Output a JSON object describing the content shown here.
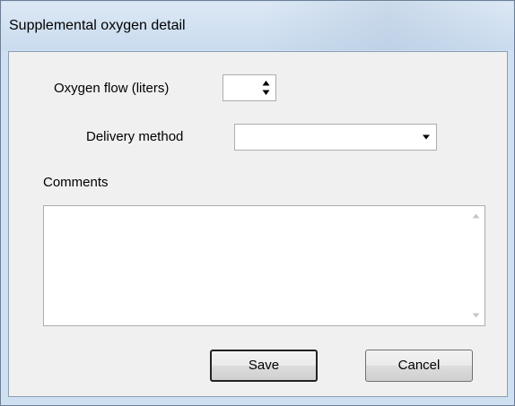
{
  "window": {
    "title": "Supplemental oxygen detail"
  },
  "form": {
    "oxygen_flow_label": "Oxygen flow (liters)",
    "oxygen_flow_value": "",
    "delivery_method_label": "Delivery method",
    "delivery_method_value": "",
    "comments_label": "Comments",
    "comments_value": ""
  },
  "buttons": {
    "save_label": "Save",
    "cancel_label": "Cancel"
  },
  "icons": {
    "spinner_arrows": "up-down-arrows-icon",
    "combo_dropdown": "chevron-down-icon",
    "scroll_up": "scroll-up-arrow-icon",
    "scroll_down": "scroll-down-arrow-icon"
  }
}
